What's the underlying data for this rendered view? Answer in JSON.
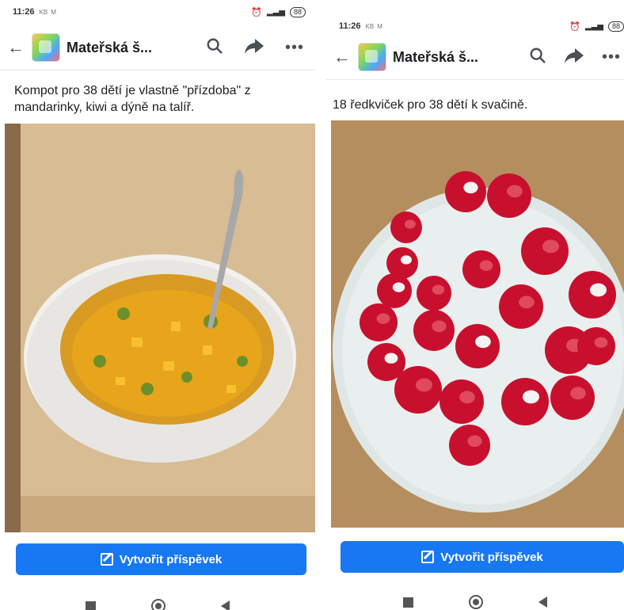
{
  "left_phone": {
    "status": {
      "time": "11:26",
      "net": "KB",
      "mail": "M",
      "battery": "88"
    },
    "appbar": {
      "title": "Mateřská š..."
    },
    "post": {
      "text": "Kompot pro 38 dětí je vlastně \"přízdoba\" z mandarinky, kiwi a dýně na talíř."
    },
    "create_button": {
      "label": "Vytvořit příspěvek"
    }
  },
  "right_phone": {
    "status": {
      "time": "11:26",
      "net": "KB",
      "mail": "M",
      "battery": "88"
    },
    "appbar": {
      "title": "Mateřská š..."
    },
    "post": {
      "text": "18 ředkviček pro 38 dětí k svačině."
    },
    "create_button": {
      "label": "Vytvořit příspěvek"
    }
  },
  "icons": {
    "back": "arrow-left",
    "search": "magnifier",
    "share": "share-arrow",
    "more": "ellipsis",
    "alarm": "alarm-clock",
    "signal": "signal-bars"
  }
}
